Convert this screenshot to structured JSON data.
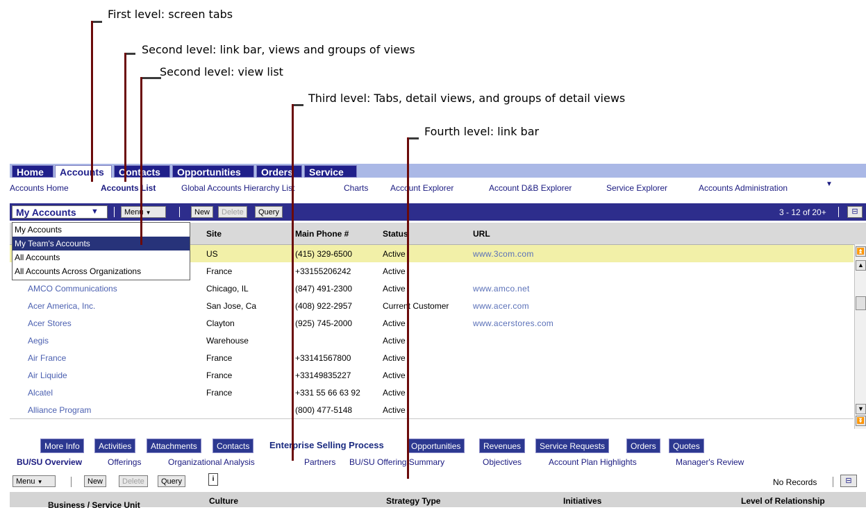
{
  "annotations": {
    "level1": "First level: screen tabs",
    "level2a": "Second level: link bar, views and groups of views",
    "level2b": "Second level: view list",
    "level3": "Third level: Tabs, detail views, and groups of detail views",
    "level4": "Fourth level: link bar"
  },
  "screen_tabs": [
    "Home",
    "Accounts",
    "Contacts",
    "Opportunities",
    "Orders",
    "Service"
  ],
  "link_bar": [
    "Accounts Home",
    "Accounts List",
    "Global Accounts Hierarchy List",
    "Charts",
    "Account Explorer",
    "Account D&B Explorer",
    "Service Explorer",
    "Accounts Administration"
  ],
  "list_toolbar": {
    "view_selector": "My Accounts",
    "menu": "Menu",
    "new": "New",
    "delete": "Delete",
    "query": "Query",
    "record_count": "3 - 12 of 20+"
  },
  "view_list": [
    "My Accounts",
    "My Team's Accounts",
    "All Accounts",
    "All Accounts Across Organizations"
  ],
  "table": {
    "columns": [
      "Site",
      "Main Phone #",
      "Status",
      "URL"
    ],
    "rows": [
      {
        "name": "",
        "site": "US",
        "phone": "(415) 329-6500",
        "status": "Active",
        "url": "www.3com.com"
      },
      {
        "name": "",
        "site": "France",
        "phone": "+33155206242",
        "status": "Active",
        "url": ""
      },
      {
        "name": "AMCO Communications",
        "site": "Chicago, IL",
        "phone": "(847) 491-2300",
        "status": "Active",
        "url": "www.amco.net"
      },
      {
        "name": "Acer America, Inc.",
        "site": "San Jose, Ca",
        "phone": "(408) 922-2957",
        "status": "Current Customer",
        "url": "www.acer.com"
      },
      {
        "name": "Acer Stores",
        "site": "Clayton",
        "phone": "(925) 745-2000",
        "status": "Active",
        "url": "www.acerstores.com"
      },
      {
        "name": "Aegis",
        "site": "Warehouse",
        "phone": "",
        "status": "Active",
        "url": ""
      },
      {
        "name": "Air France",
        "site": "France",
        "phone": "+33141567800",
        "status": "Active",
        "url": ""
      },
      {
        "name": "Air Liquide",
        "site": "France",
        "phone": "+33149835227",
        "status": "Active",
        "url": ""
      },
      {
        "name": "Alcatel",
        "site": "France",
        "phone": "+331 55 66 63 92",
        "status": "Active",
        "url": ""
      },
      {
        "name": "Alliance Program",
        "site": "",
        "phone": "(800) 477-5148",
        "status": "Active",
        "url": ""
      }
    ]
  },
  "detail_tabs": [
    "More Info",
    "Activities",
    "Attachments",
    "Contacts",
    "Enterprise Selling Process",
    "Opportunities",
    "Revenues",
    "Service Requests",
    "Orders",
    "Quotes"
  ],
  "detail_links": [
    "BU/SU Overview",
    "Offerings",
    "Organizational Analysis",
    "Partners",
    "BU/SU Offering Summary",
    "Objectives",
    "Account Plan Highlights",
    "Manager's Review"
  ],
  "detail_toolbar": {
    "menu": "Menu",
    "new": "New",
    "delete": "Delete",
    "query": "Query",
    "record_status": "No Records"
  },
  "detail_columns": [
    "Business / Service Unit",
    "Culture",
    "Strategy Type",
    "Initiatives",
    "Level of Relationship"
  ]
}
